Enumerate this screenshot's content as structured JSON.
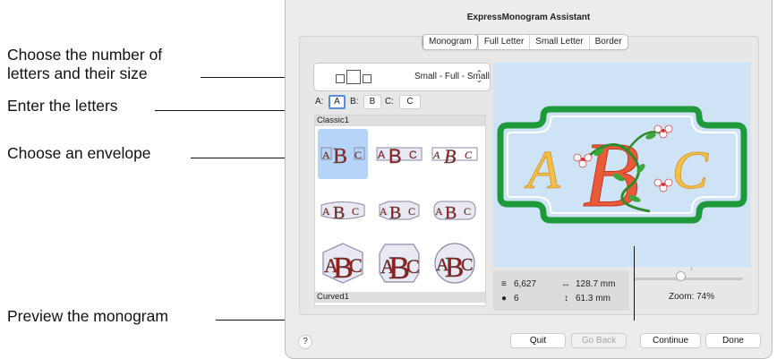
{
  "callouts": {
    "letters_size_line1": "Choose the number of",
    "letters_size_line2": "letters and their size",
    "enter_letters": "Enter the letters",
    "envelope": "Choose an envelope",
    "preview": "Preview the monogram"
  },
  "window": {
    "title": "ExpressMonogram Assistant",
    "tabs": [
      "Monogram",
      "Full Letter",
      "Small Letter",
      "Border"
    ],
    "active_tab": "Monogram"
  },
  "size_selector": {
    "value": "Small - Full - Small",
    "icon": "small-full-small-squares-icon"
  },
  "letters": {
    "a_label": "A:",
    "a_value": "A",
    "b_label": "B:",
    "b_value": "B",
    "c_label": "C:",
    "c_value": "C"
  },
  "envelope_list": {
    "groups": [
      "Classic1",
      "Curved1"
    ],
    "thumbnail_text": "ABC",
    "selected_index": 0
  },
  "preview_text": {
    "a": "A",
    "b": "B",
    "c": "C"
  },
  "stats": {
    "stitches": "6,627",
    "colors": "6",
    "width": "128.7 mm",
    "height": "61.3 mm"
  },
  "zoom": {
    "label": "Zoom: 74%",
    "value_percent": 74
  },
  "buttons": {
    "help": "?",
    "quit": "Quit",
    "go_back": "Go Back",
    "continue": "Continue",
    "done": "Done"
  },
  "colors": {
    "accent": "#5a8fd6",
    "selection": "#b6d4f7",
    "preview_bg": "#cfe3f7",
    "border_green": "#1f9a3a",
    "letter_yellow": "#f3c24a",
    "letter_red": "#ea5a3a",
    "envelope_red": "#9b1c1c"
  }
}
